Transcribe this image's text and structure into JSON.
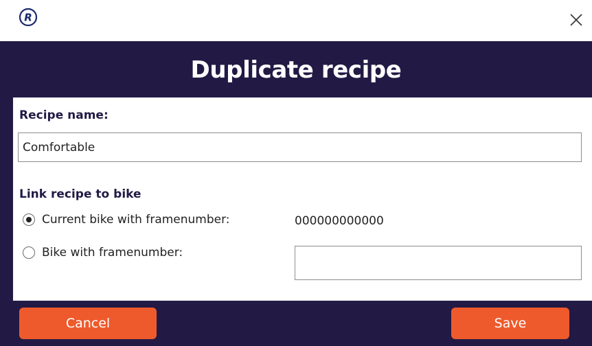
{
  "titlebar": {
    "logo_icon": "r-circle-logo-icon",
    "close_icon": "close-icon"
  },
  "dialog": {
    "title": "Duplicate recipe"
  },
  "recipe": {
    "label": "Recipe name:",
    "value": "Comfortable"
  },
  "link": {
    "label": "Link recipe to bike",
    "options": [
      {
        "label": "Current bike with framenumber:",
        "checked": true,
        "framenumber": "000000000000"
      },
      {
        "label": "Bike with framenumber:",
        "checked": false,
        "input_value": ""
      }
    ]
  },
  "buttons": {
    "cancel": "Cancel",
    "save": "Save"
  },
  "colors": {
    "header_bg": "#221a45",
    "button_bg": "#ee5a2c",
    "text": "#222222"
  }
}
